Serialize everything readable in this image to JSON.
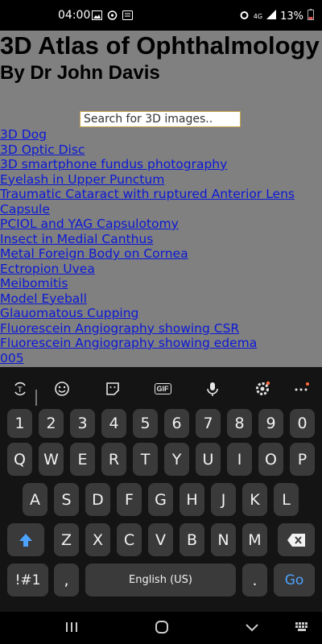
{
  "status_bar": {
    "time": "04:00",
    "battery_text": "13%",
    "network_label": "4G"
  },
  "page": {
    "title": "3D Atlas of Ophthalmology",
    "subtitle": "By Dr John Davis",
    "search_placeholder": "Search for 3D images..",
    "links": [
      "3D Dog",
      "3D Optic Disc",
      "3D smartphone fundus photography",
      "Eyelash in Upper Punctum",
      "Traumatic Cataract with ruptured Anterior Lens",
      "Capsule",
      "PCIOL and YAG Capsulotomy",
      "Insect in Medial Canthus",
      "Metal Foreign Body on Cornea",
      "Ectropion Uvea",
      "Meibomitis",
      "Model Eyeball",
      "Glauomatous Cupping",
      "Fluorescein Angiography showing CSR",
      "Fluorescein Angiography showing edema",
      "005"
    ],
    "colors": {
      "background": "#808080",
      "link": "#0b18d6"
    }
  },
  "keyboard": {
    "toolbar_gif": "GIF",
    "row_numbers": [
      "1",
      "2",
      "3",
      "4",
      "5",
      "6",
      "7",
      "8",
      "9",
      "0"
    ],
    "row1": [
      "Q",
      "W",
      "E",
      "R",
      "T",
      "Y",
      "U",
      "I",
      "O",
      "P"
    ],
    "row2": [
      "A",
      "S",
      "D",
      "F",
      "G",
      "H",
      "J",
      "K",
      "L"
    ],
    "row3": [
      "Z",
      "X",
      "C",
      "V",
      "B",
      "N",
      "M"
    ],
    "symbols_label": "!#1",
    "comma": ",",
    "space_label": "English (US)",
    "period": ".",
    "go_label": "Go"
  }
}
